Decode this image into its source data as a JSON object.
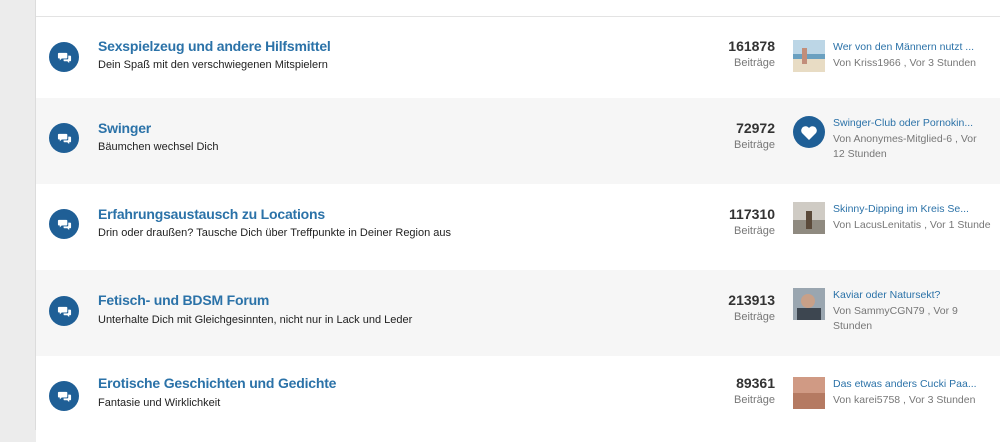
{
  "count_label": "Beiträge",
  "forums": [
    {
      "title": "Sexspielzeug und andere Hilfsmittel",
      "desc": "Dein Spaß mit den verschwiegenen Mitspielern",
      "count": "161878",
      "last_title": "Wer von den Männern nutzt ...",
      "last_meta": "Von Kriss1966 , Vor 3 Stunden",
      "avatar": "beach-photo"
    },
    {
      "title": "Swinger",
      "desc": "Bäumchen wechsel Dich",
      "count": "72972",
      "last_title": "Swinger-Club oder Pornokin...",
      "last_meta": "Von Anonymes-Mitglied-6 , Vor 12 Stunden",
      "avatar": "heart-logo"
    },
    {
      "title": "Erfahrungsaustausch zu Locations",
      "desc": "Drin oder draußen? Tausche Dich über Treffpunkte in Deiner Region aus",
      "count": "117310",
      "last_title": "Skinny-Dipping im Kreis Se...",
      "last_meta": "Von LacusLenitatis , Vor 1 Stunde",
      "avatar": "figure-photo"
    },
    {
      "title": "Fetisch- und BDSM Forum",
      "desc": "Unterhalte Dich mit Gleichgesinnten, nicht nur in Lack und Leder",
      "count": "213913",
      "last_title": "Kaviar oder Natursekt?",
      "last_meta": "Von SammyCGN79 , Vor 9 Stunden",
      "avatar": "person-photo"
    },
    {
      "title": "Erotische Geschichten und Gedichte",
      "desc": "Fantasie und Wirklichkeit",
      "count": "89361",
      "last_title": "Das etwas anders Cucki Paa...",
      "last_meta": "Von karei5758 , Vor 3 Stunden",
      "avatar": "skin-photo"
    }
  ],
  "colors": {
    "accent": "#2b72a8",
    "icon_bg": "#1f5f96",
    "alt_row": "#f6f6f6"
  }
}
